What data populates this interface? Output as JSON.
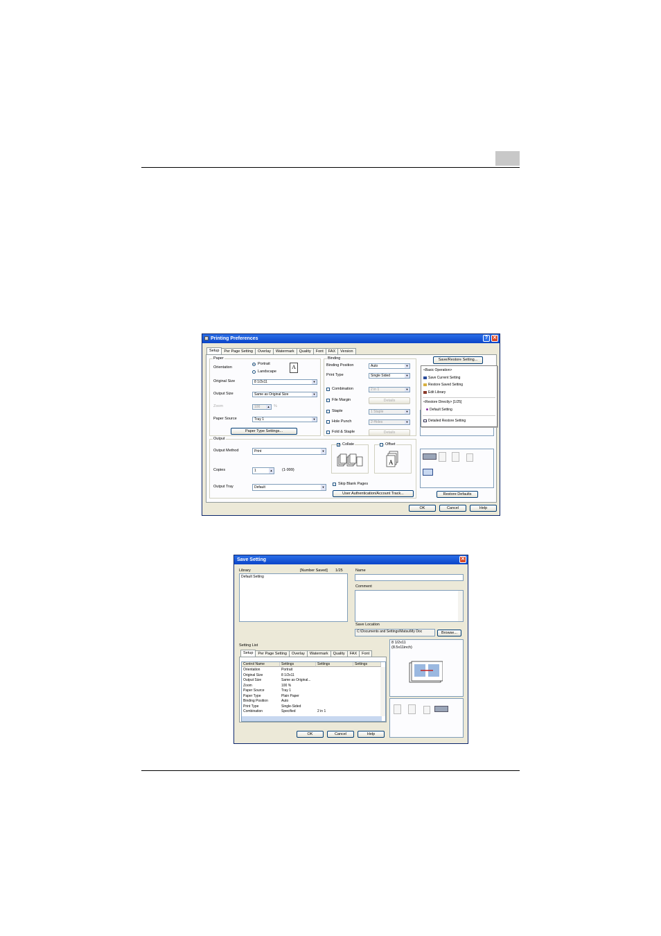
{
  "printing_prefs": {
    "title": "Printing Preferences",
    "help_glyph": "?",
    "close_glyph": "✕",
    "tabs": [
      "Setup",
      "Per Page Setting",
      "Overlay",
      "Watermark",
      "Quality",
      "Font",
      "FAX",
      "Version"
    ],
    "paper": {
      "group": "Paper",
      "orientation_label": "Orientation",
      "portrait": "Portrait",
      "landscape": "Landscape",
      "original_size_label": "Original Size",
      "original_size": "8 1/2x11",
      "output_size_label": "Output Size",
      "output_size": "Same as Original Size",
      "zoom_label": "Zoom",
      "zoom_value": "100",
      "zoom_unit": "%",
      "paper_source_label": "Paper Source",
      "paper_source": "Tray 1",
      "paper_type_button": "Paper Type Settings..."
    },
    "binding": {
      "group": "Binding",
      "binding_position_label": "Binding Position",
      "binding_position": "Auto",
      "print_type_label": "Print Type",
      "print_type": "Single Sided",
      "combination": "Combination",
      "combination_value": "2 in 1",
      "details": "Details",
      "file_margin": "File Margin",
      "staple": "Staple",
      "staple_value": "1 Staple",
      "hole_punch": "Hole Punch",
      "hole_punch_value": "2-Holes",
      "fold_staple": "Fold & Staple"
    },
    "output": {
      "group": "Output",
      "output_method_label": "Output Method",
      "output_method": "Print",
      "copies_label": "Copies",
      "copies": "1",
      "copies_range": "(1-999)",
      "output_tray_label": "Output Tray",
      "output_tray": "Default",
      "collate": "Collate",
      "offset": "Offset",
      "skip_blank": "Skip Blank Pages",
      "user_auth_button": "User Authentication/Account Track..."
    },
    "save_restore_button": "Save/Restore Setting...",
    "menu": {
      "basic_header": "<Basic Operation>",
      "save_current": "Save Current Setting",
      "restore_saved": "Restore Saved Setting",
      "edit_library": "Edit Library",
      "restore_directly": "<Restore Directly> [1/25]",
      "default_setting": "Default Setting",
      "detailed_restore": "Detailed Restore Setting"
    },
    "restore_defaults": "Restore Defaults",
    "ok": "OK",
    "cancel": "Cancel",
    "help": "Help"
  },
  "save_setting": {
    "title": "Save Setting",
    "close_glyph": "✕",
    "library_label": "Library",
    "number_saved_label": "[Number Saved]",
    "number_saved": "1/25",
    "library_items": [
      "Default Setting"
    ],
    "name_label": "Name",
    "comment_label": "Comment",
    "save_location_label": "Save Location",
    "save_location": "C:\\Documents and Settings\\Matsu\\My Doc",
    "browse_button": "Browse...",
    "setting_list_label": "Setting List",
    "tabs": [
      "Setup",
      "Per Page Setting",
      "Overlay",
      "Watermark",
      "Quality",
      "FAX",
      "Font"
    ],
    "columns": [
      "Control Name",
      "Settings",
      "Settings",
      "Settings"
    ],
    "rows": [
      [
        "Orientation",
        "Portrait",
        ""
      ],
      [
        "Original Size",
        "8 1/2x11",
        ""
      ],
      [
        "Output Size",
        "Same as Original...",
        ""
      ],
      [
        "Zoom",
        "100 %",
        ""
      ],
      [
        "Paper Source",
        "Tray 1",
        ""
      ],
      [
        "Paper Type",
        "Plain Paper",
        ""
      ],
      [
        "Binding Position",
        "Auto",
        ""
      ],
      [
        "Print Type",
        "Single-Sided",
        ""
      ],
      [
        "Combination",
        "Specified",
        "2 in 1"
      ]
    ],
    "preview_size": "8 1/2x11",
    "preview_dims": "(8.5x11inch)",
    "ok": "OK",
    "cancel": "Cancel",
    "help": "Help"
  }
}
